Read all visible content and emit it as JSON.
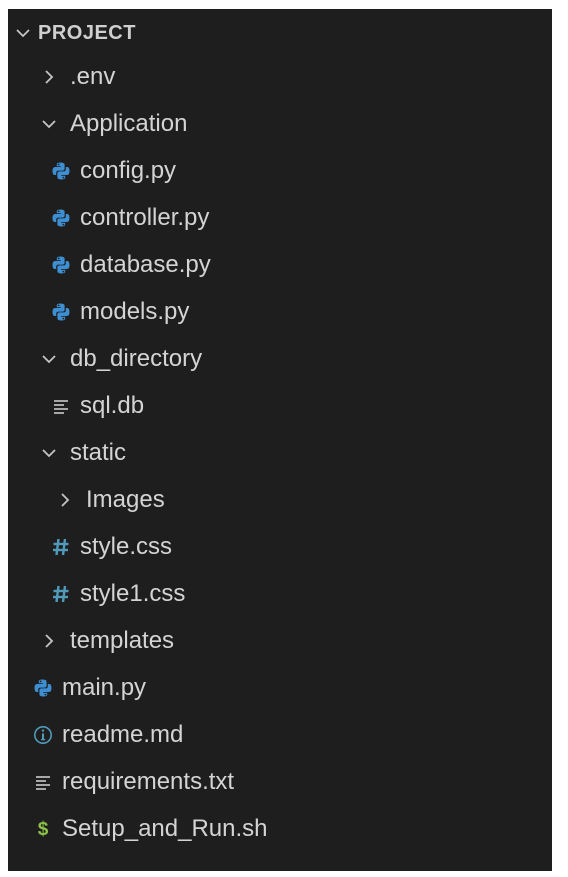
{
  "explorer": {
    "section_title": "PROJECT",
    "items": [
      {
        "label": ".env",
        "kind": "folder",
        "expanded": false,
        "depth": 1,
        "icon": "chevron-right-icon"
      },
      {
        "label": "Application",
        "kind": "folder",
        "expanded": true,
        "depth": 1,
        "icon": "chevron-down-icon"
      },
      {
        "label": "config.py",
        "kind": "python",
        "depth": 2,
        "icon": "python-icon"
      },
      {
        "label": "controller.py",
        "kind": "python",
        "depth": 2,
        "icon": "python-icon"
      },
      {
        "label": "database.py",
        "kind": "python",
        "depth": 2,
        "icon": "python-icon"
      },
      {
        "label": "models.py",
        "kind": "python",
        "depth": 2,
        "icon": "python-icon"
      },
      {
        "label": "db_directory",
        "kind": "folder",
        "expanded": true,
        "depth": 1,
        "icon": "chevron-down-icon"
      },
      {
        "label": "sql.db",
        "kind": "text",
        "depth": 2,
        "icon": "lines-icon"
      },
      {
        "label": "static",
        "kind": "folder",
        "expanded": true,
        "depth": 1,
        "icon": "chevron-down-icon"
      },
      {
        "label": "Images",
        "kind": "folder",
        "expanded": false,
        "depth": 2,
        "icon": "chevron-right-icon"
      },
      {
        "label": "style.css",
        "kind": "css",
        "depth": 2,
        "icon": "hash-icon"
      },
      {
        "label": "style1.css",
        "kind": "css",
        "depth": 2,
        "icon": "hash-icon"
      },
      {
        "label": "templates",
        "kind": "folder",
        "expanded": false,
        "depth": 1,
        "icon": "chevron-right-icon"
      },
      {
        "label": "main.py",
        "kind": "python",
        "depth": 1,
        "icon": "python-icon"
      },
      {
        "label": "readme.md",
        "kind": "info",
        "depth": 1,
        "icon": "info-icon"
      },
      {
        "label": "requirements.txt",
        "kind": "text",
        "depth": 1,
        "icon": "lines-icon"
      },
      {
        "label": "Setup_and_Run.sh",
        "kind": "shell",
        "depth": 1,
        "icon": "dollar-icon"
      }
    ]
  },
  "colors": {
    "background": "#1e1e1f",
    "text": "#d4d4d4",
    "python_blue": "#3d8fd1",
    "css_blue": "#519aba",
    "shell_green": "#8dc149",
    "info_blue": "#519aba",
    "chevron": "#c5c5c5"
  }
}
